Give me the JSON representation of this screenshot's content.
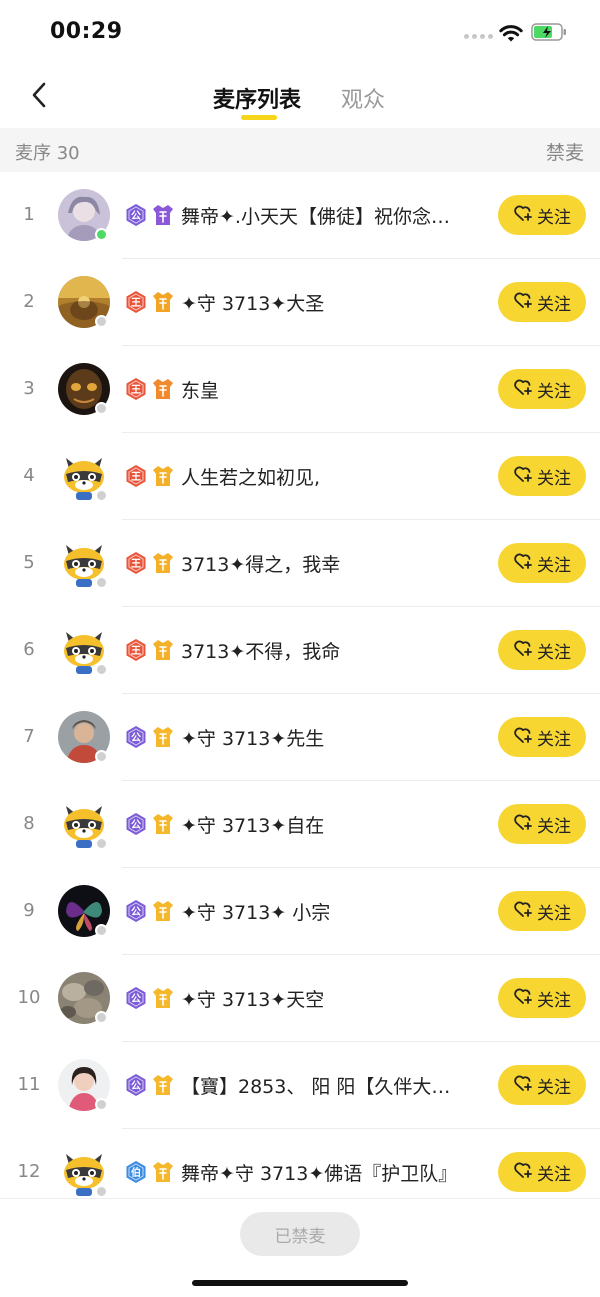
{
  "status_bar": {
    "time": "00:29"
  },
  "nav": {
    "tabs": [
      "麦序列表",
      "观众"
    ]
  },
  "section": {
    "count_label": "麦序 30",
    "ban_label": "禁麦"
  },
  "follow_label": "关注",
  "rows": [
    {
      "index": "1",
      "name": "舞帝✦.小天天【佛徒】祝你念…",
      "badge1": "公",
      "badge1_color": "#7b5bd6",
      "badge2_color": "#8a58d8",
      "online": true,
      "avatar": "portrait-lilac"
    },
    {
      "index": "2",
      "name": "✦守 3713✦大圣",
      "badge1": "王",
      "badge1_color": "#e8553a",
      "badge2_color": "#f2a424",
      "online": false,
      "avatar": "portrait-golden"
    },
    {
      "index": "3",
      "name": "东皇",
      "badge1": "王",
      "badge1_color": "#e8553a",
      "badge2_color": "#f08a2c",
      "online": false,
      "avatar": "portrait-dark-mask"
    },
    {
      "index": "4",
      "name": "人生若之如初见,",
      "badge1": "王",
      "badge1_color": "#e8553a",
      "badge2_color": "#f5b02a",
      "online": false,
      "avatar": "raccoon-mascot"
    },
    {
      "index": "5",
      "name": "3713✦得之，我幸",
      "badge1": "王",
      "badge1_color": "#e8553a",
      "badge2_color": "#f5b02a",
      "online": false,
      "avatar": "raccoon-mascot"
    },
    {
      "index": "6",
      "name": "3713✦不得，我命",
      "badge1": "王",
      "badge1_color": "#e8553a",
      "badge2_color": "#f5b02a",
      "online": false,
      "avatar": "raccoon-mascot"
    },
    {
      "index": "7",
      "name": "✦守 3713✦先生",
      "badge1": "公",
      "badge1_color": "#7b5bd6",
      "badge2_color": "#f5b82c",
      "online": false,
      "avatar": "portrait-person"
    },
    {
      "index": "8",
      "name": "✦守 3713✦自在",
      "badge1": "公",
      "badge1_color": "#7b5bd6",
      "badge2_color": "#f5b82c",
      "online": false,
      "avatar": "raccoon-mascot"
    },
    {
      "index": "9",
      "name": "✦守 3713✦ 小宗",
      "badge1": "公",
      "badge1_color": "#7b5bd6",
      "badge2_color": "#f5b82c",
      "online": false,
      "avatar": "portrait-butterfly"
    },
    {
      "index": "10",
      "name": "✦守 3713✦天空",
      "badge1": "公",
      "badge1_color": "#7b5bd6",
      "badge2_color": "#f5b82c",
      "online": false,
      "avatar": "portrait-stones"
    },
    {
      "index": "11",
      "name": "【寶】2853、 阳  阳【久伴大…",
      "badge1": "公",
      "badge1_color": "#7b5bd6",
      "badge2_color": "#f5b82c",
      "online": false,
      "avatar": "portrait-woman"
    },
    {
      "index": "12",
      "name": "舞帝✦守 3713✦佛语『护卫队』",
      "badge1": "伯",
      "badge1_color": "#3b8be0",
      "badge2_color": "#f5b82c",
      "online": false,
      "avatar": "raccoon-mascot"
    }
  ],
  "bottom": {
    "button_label": "已禁麦"
  },
  "colors": {
    "accent": "#f8d632",
    "online": "#4cd964"
  }
}
